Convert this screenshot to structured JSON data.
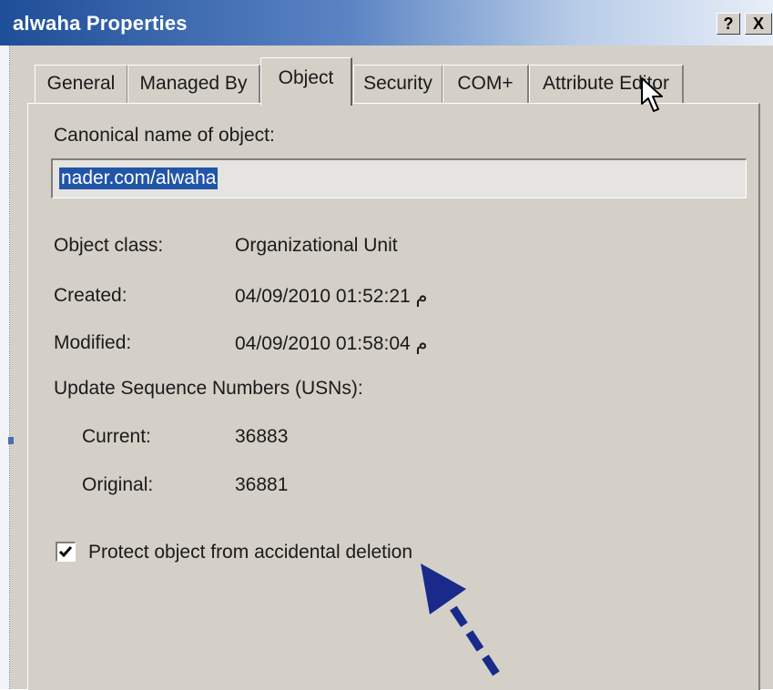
{
  "window": {
    "title": "alwaha Properties",
    "help_label": "?",
    "close_label": "X"
  },
  "tabs": [
    {
      "label": "General",
      "active": false
    },
    {
      "label": "Managed By",
      "active": false
    },
    {
      "label": "Object",
      "active": true
    },
    {
      "label": "Security",
      "active": false
    },
    {
      "label": "COM+",
      "active": false
    },
    {
      "label": "Attribute Editor",
      "active": false
    }
  ],
  "object_tab": {
    "canonical_label": "Canonical name of object:",
    "canonical_value": "nader.com/alwaha",
    "fields": [
      {
        "label": "Object class:",
        "value": "Organizational Unit"
      },
      {
        "label": "Created:",
        "value": "04/09/2010 01:52:21 م"
      },
      {
        "label": "Modified:",
        "value": "04/09/2010 01:58:04 م"
      }
    ],
    "usn_header": "Update Sequence Numbers (USNs):",
    "usn": [
      {
        "label": "Current:",
        "value": "36883"
      },
      {
        "label": "Original:",
        "value": "36881"
      }
    ],
    "protect_label": "Protect object from accidental deletion",
    "protect_checked": true
  },
  "colors": {
    "titlebar_start": "#1e4e98",
    "dialog_face": "#d4d0c8",
    "selection": "#2155a8",
    "annotation_arrow": "#1a2a8a"
  },
  "icons": {
    "cursor": "arrow-cursor-icon",
    "annotation": "annotation-arrow-icon"
  }
}
